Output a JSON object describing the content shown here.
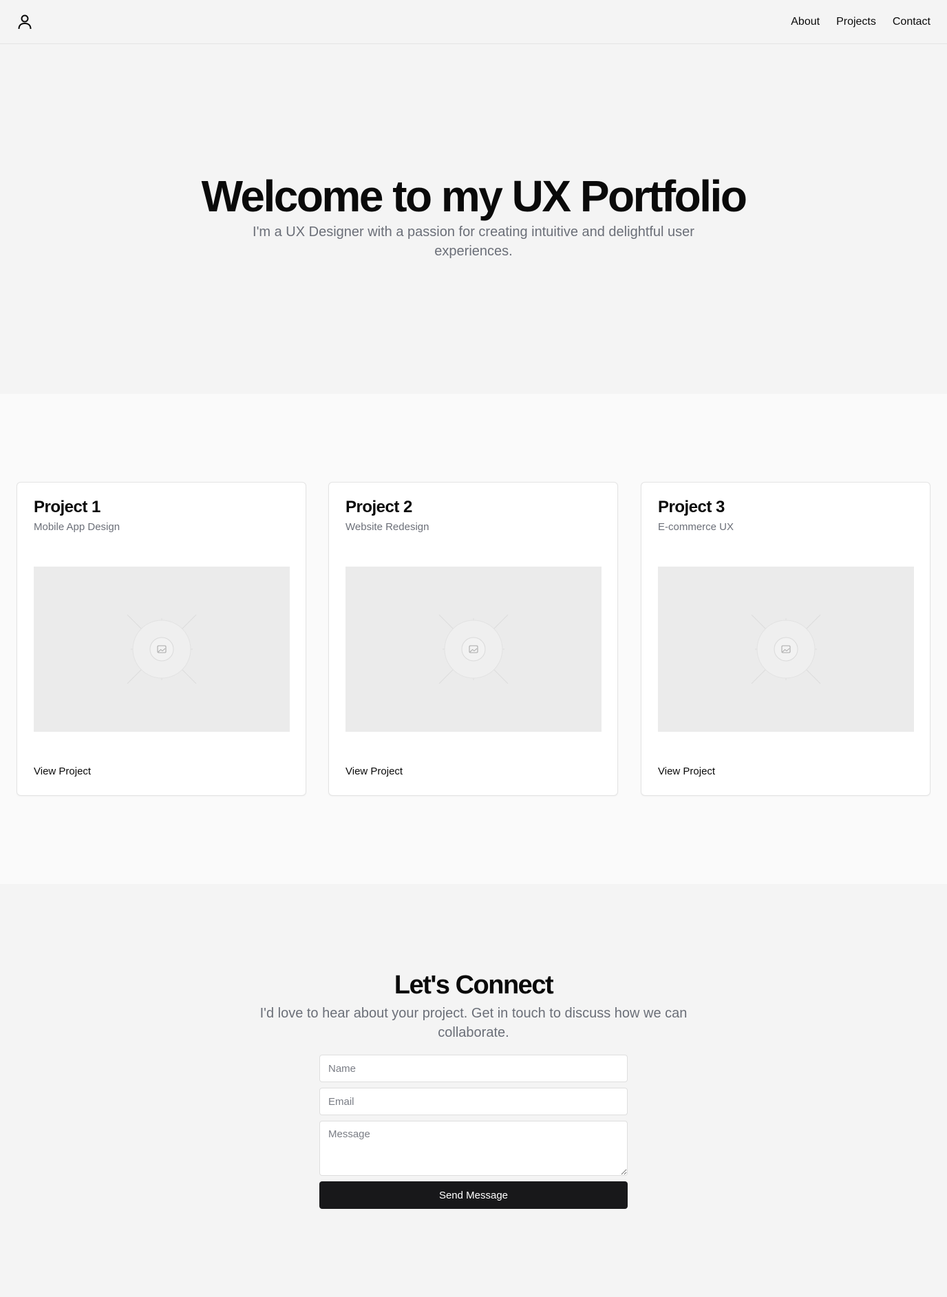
{
  "header": {
    "logo_icon": "user-icon",
    "nav": [
      {
        "label": "About"
      },
      {
        "label": "Projects"
      },
      {
        "label": "Contact"
      }
    ]
  },
  "hero": {
    "title": "Welcome to my UX Portfolio",
    "subtitle": "I'm a UX Designer with a passion for creating intuitive and delightful user experiences."
  },
  "projects": [
    {
      "title": "Project 1",
      "subtitle": "Mobile App Design",
      "image_icon": "image-placeholder-icon",
      "link": "View Project"
    },
    {
      "title": "Project 2",
      "subtitle": "Website Redesign",
      "image_icon": "image-placeholder-icon",
      "link": "View Project"
    },
    {
      "title": "Project 3",
      "subtitle": "E-commerce UX",
      "image_icon": "image-placeholder-icon",
      "link": "View Project"
    }
  ],
  "contact": {
    "title": "Let's Connect",
    "subtitle": "I'd love to hear about your project. Get in touch to discuss how we can collaborate.",
    "name_placeholder": "Name",
    "name_value": "",
    "email_placeholder": "Email",
    "email_value": "",
    "message_placeholder": "Message",
    "message_value": "",
    "submit_label": "Send Message"
  },
  "colors": {
    "background": "#f4f4f4",
    "projects_background": "#fafafa",
    "card_background": "#ffffff",
    "muted_text": "#6b6f78",
    "button_background": "#18181a",
    "button_text": "#ffffff",
    "placeholder_fill": "#ebebeb"
  }
}
